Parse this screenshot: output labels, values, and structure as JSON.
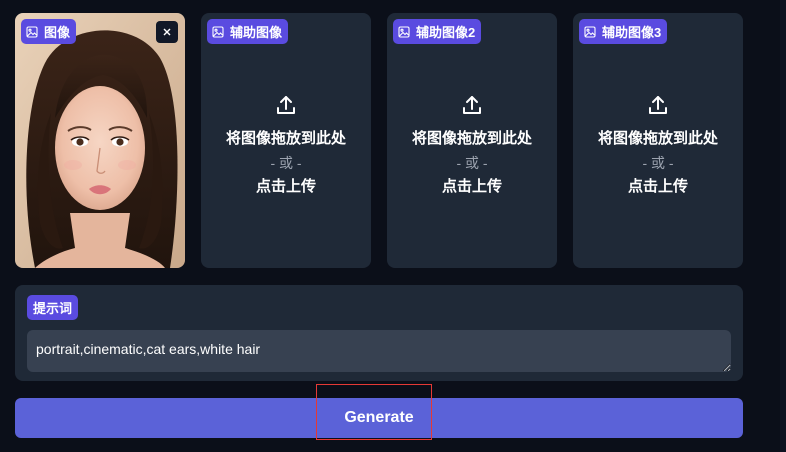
{
  "colors": {
    "background": "#0b0f19",
    "panel": "#1f2937",
    "label_badge": "#5a4be0",
    "input": "#374151",
    "generate_button": "#5b62d8",
    "highlight_box": "#e53935"
  },
  "main_image": {
    "label": "图像",
    "icon": "image-icon",
    "close_icon": "close-icon"
  },
  "aux_images": [
    {
      "label": "辅助图像",
      "icon": "image-icon",
      "upload_icon": "upload-icon",
      "drop_text": "将图像拖放到此处",
      "or_text": "- 或 -",
      "click_text": "点击上传"
    },
    {
      "label": "辅助图像2",
      "icon": "image-icon",
      "upload_icon": "upload-icon",
      "drop_text": "将图像拖放到此处",
      "or_text": "- 或 -",
      "click_text": "点击上传"
    },
    {
      "label": "辅助图像3",
      "icon": "image-icon",
      "upload_icon": "upload-icon",
      "drop_text": "将图像拖放到此处",
      "or_text": "- 或 -",
      "click_text": "点击上传"
    }
  ],
  "prompt": {
    "label": "提示词",
    "value": "portrait,cinematic,cat ears,white hair"
  },
  "generate": {
    "label": "Generate"
  }
}
